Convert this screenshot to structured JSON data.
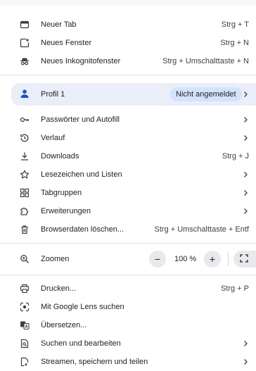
{
  "menu": {
    "new_tab": {
      "label": "Neuer Tab",
      "shortcut": "Strg + T",
      "icon": "new-tab-icon"
    },
    "new_window": {
      "label": "Neues Fenster",
      "shortcut": "Strg + N",
      "icon": "new-window-icon"
    },
    "incognito": {
      "label": "Neues Inkognitofenster",
      "shortcut": "Strg + Umschalttaste + N",
      "icon": "incognito-icon"
    },
    "profile": {
      "label": "Profil 1",
      "status": "Nicht angemeldet",
      "icon": "person-icon"
    },
    "passwords": {
      "label": "Passwörter und Autofill",
      "icon": "key-icon"
    },
    "history": {
      "label": "Verlauf",
      "icon": "history-icon"
    },
    "downloads": {
      "label": "Downloads",
      "shortcut": "Strg + J",
      "icon": "download-icon"
    },
    "bookmarks": {
      "label": "Lesezeichen und Listen",
      "icon": "star-icon"
    },
    "tab_groups": {
      "label": "Tabgruppen",
      "icon": "tab-groups-icon"
    },
    "extensions": {
      "label": "Erweiterungen",
      "icon": "puzzle-icon"
    },
    "clear_data": {
      "label": "Browserdaten löschen...",
      "shortcut": "Strg + Umschalttaste + Entf",
      "icon": "trash-icon"
    },
    "zoom": {
      "label": "Zoomen",
      "value": "100 %",
      "minus": "−",
      "plus": "+",
      "icon": "zoom-icon"
    },
    "print": {
      "label": "Drucken...",
      "shortcut": "Strg + P",
      "icon": "print-icon"
    },
    "lens": {
      "label": "Mit Google Lens suchen",
      "icon": "lens-icon"
    },
    "translate": {
      "label": "Übersetzen...",
      "icon": "translate-icon"
    },
    "find_edit": {
      "label": "Suchen und bearbeiten",
      "icon": "find-icon"
    },
    "cast_save_share": {
      "label": "Streamen, speichern und teilen",
      "icon": "cast-icon"
    }
  },
  "colors": {
    "accent": "#0b57d0",
    "profile_bg": "#e9eef8",
    "badge_bg": "#d3e3fd"
  }
}
